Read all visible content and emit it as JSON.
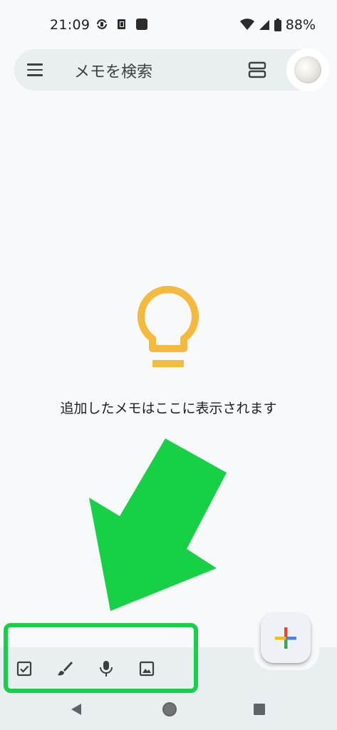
{
  "status_bar": {
    "time": "21:09",
    "battery": "88%",
    "icons": [
      "sync-icon",
      "paste-icon",
      "app-square-icon",
      "wifi-icon",
      "signal-icon",
      "battery-icon"
    ]
  },
  "search_bar": {
    "placeholder": "メモを検索"
  },
  "empty_state": {
    "message": "追加したメモはここに表示されます",
    "icon": "lightbulb-icon"
  },
  "bottom_toolbar": {
    "tools": [
      "checkbox-icon",
      "brush-icon",
      "mic-icon",
      "image-icon"
    ]
  },
  "fab": {
    "icon": "google-plus-icon"
  },
  "nav_bar": {
    "icons": [
      "back-icon",
      "home-icon",
      "recents-icon"
    ]
  },
  "colors": {
    "accent_yellow": "#f4b93d",
    "annotation_green": "#16d145",
    "bar_bg": "#e9eef0",
    "page_bg": "#f8f9fb"
  }
}
